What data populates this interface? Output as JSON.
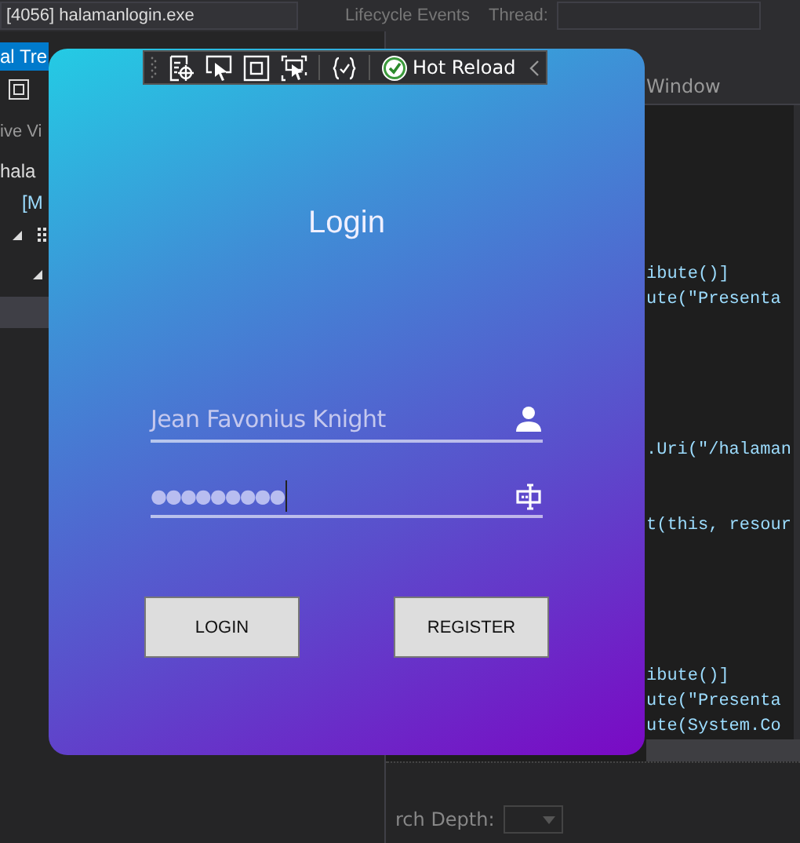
{
  "process_selector": {
    "value": "[4056] halamanlogin.exe"
  },
  "debug_toolbar": {
    "lifecycle": "Lifecycle Events",
    "thread_label": "Thread:"
  },
  "live_visual_tree": {
    "tab": "al Tre",
    "header": "ive Vi",
    "items": [
      {
        "label": "hala"
      },
      {
        "label": "[M"
      }
    ]
  },
  "editor": {
    "tab": "Window",
    "code_blocks": [
      [
        "ibute()]",
        "ute(\"Presenta"
      ],
      [
        ".Uri(\"/halaman"
      ],
      [
        "t(this, resour"
      ],
      [
        "ibute()]",
        "ute(\"Presenta",
        "ute(System.Co"
      ]
    ]
  },
  "search_depth": {
    "label": "rch Depth:"
  },
  "hot_reload_bar": {
    "label": "Hot Reload"
  },
  "login_window": {
    "title": "Login",
    "username": {
      "value": "Jean Favonius Knight"
    },
    "password": {
      "value": "●●●●●●●●●"
    },
    "buttons": [
      {
        "label": "LOGIN"
      },
      {
        "label": "REGISTER"
      }
    ]
  }
}
